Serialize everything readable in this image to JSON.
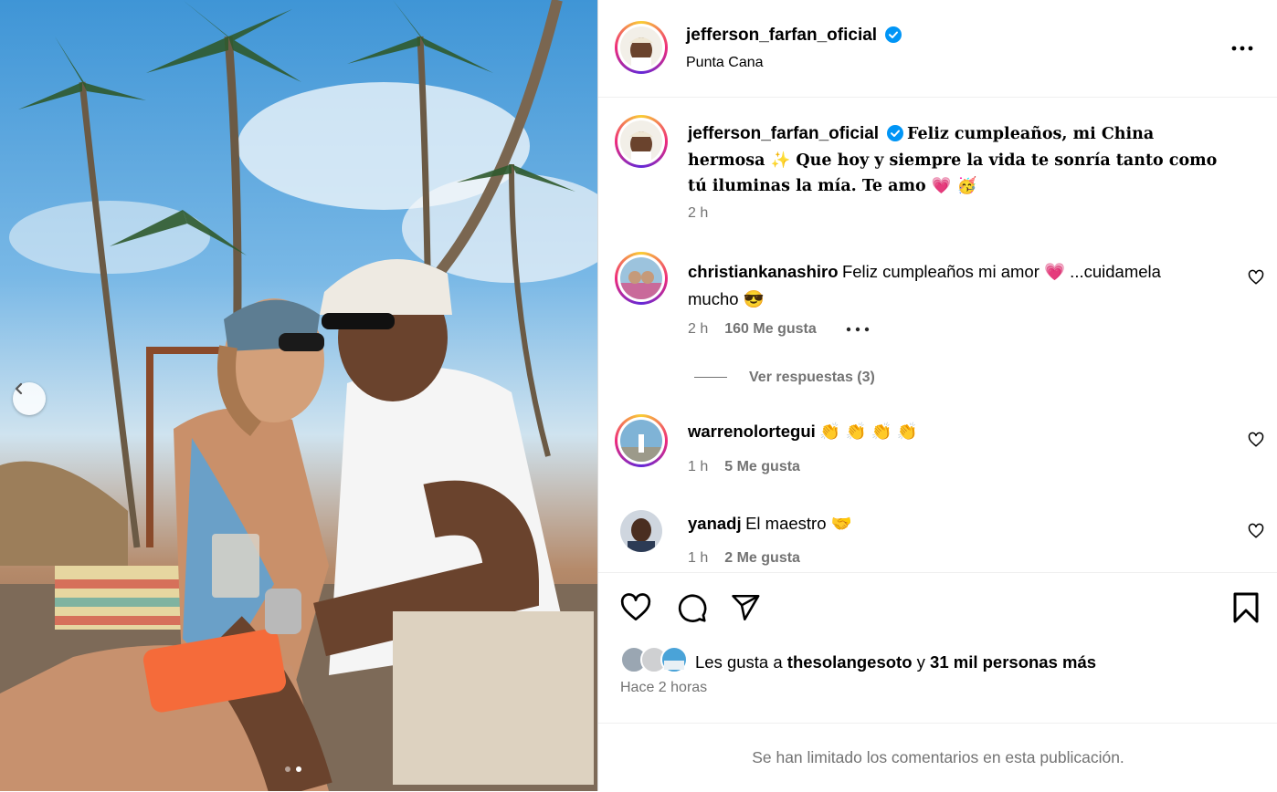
{
  "post": {
    "username": "jefferson_farfan_oficial",
    "location": "Punta Cana",
    "caption": "Feliz cumpleaños, mi China hermosa ✨ Que hoy y siempre la vida te sonría tanto como tú iluminas la mía. Te amo 💗 🥳",
    "caption_line1": "Feliz cumpleaños, mi China",
    "caption_line2": "hermosa ✨ Que hoy y siempre la vida te sonría tanto como",
    "caption_line3": "tú iluminas la mía. Te amo 💗 🥳",
    "caption_time": "2 h"
  },
  "comments": [
    {
      "username": "christiankanashiro",
      "text_line1": "Feliz cumpleaños mi amor 💗 ...cuidamela",
      "text_line2": "mucho 😎",
      "time": "2 h",
      "likes": "160 Me gusta",
      "replies": "Ver respuestas (3)"
    },
    {
      "username": "warrenolortegui",
      "text": "👏 👏 👏 👏",
      "time": "1 h",
      "likes": "5 Me gusta"
    },
    {
      "username": "yanadj",
      "text": "El maestro 🤝",
      "time": "1 h",
      "likes": "2 Me gusta"
    }
  ],
  "likes_summary": {
    "prefix": "Les gusta a",
    "user": "thesolangesoto",
    "joiner": "y",
    "others": "31 mil personas más"
  },
  "posted_ago": "Hace 2 horas",
  "comments_limited": "Se han limitado los comentarios en esta publicación.",
  "carousel": {
    "total": 2,
    "active": 2
  },
  "icons": [
    "chevron-left-icon",
    "more-icon",
    "verified-icon",
    "heart-icon",
    "comment-icon",
    "share-icon",
    "bookmark-icon"
  ],
  "colors": {
    "verified": "#0095f6",
    "muted": "#737373",
    "divider": "#efefef"
  }
}
